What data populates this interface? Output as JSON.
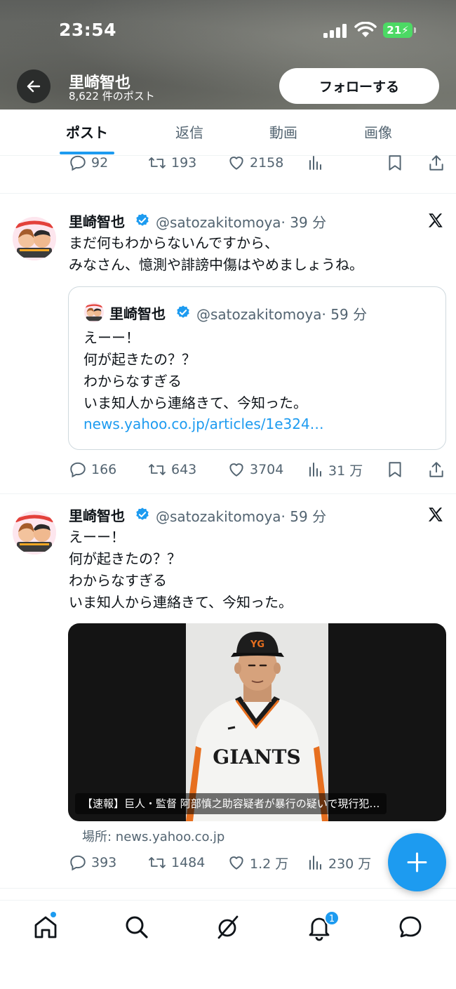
{
  "status_bar": {
    "time": "23:54",
    "battery": "21",
    "battery_color": "#4cd964"
  },
  "header": {
    "back_icon": "arrow-left-icon",
    "profile_name": "里崎智也",
    "post_count": "8,622 件のポスト",
    "follow_label": "フォローする"
  },
  "tabs": [
    {
      "label": "ポスト",
      "active": true
    },
    {
      "label": "返信",
      "active": false
    },
    {
      "label": "動画",
      "active": false
    },
    {
      "label": "画像",
      "active": false
    }
  ],
  "accent_color": "#1d9bf0",
  "top_partial_post": {
    "replies": "92",
    "reposts": "193",
    "likes": "2158"
  },
  "posts": [
    {
      "name": "里崎智也",
      "handle": "@satozakitomoya",
      "time": "· 39 分",
      "text": "まだ何もわからないんですから、\nみなさん、憶測や誹謗中傷はやめましょうね。",
      "quote": {
        "name": "里崎智也",
        "handle": "@satozakitomoya",
        "time": "· 59 分",
        "text": "えーー！\n何が起きたの？？\nわからなすぎる\nいま知人から連絡きて、今知った。",
        "link": "news.yahoo.co.jp/articles/1e324…"
      },
      "replies": "166",
      "reposts": "643",
      "likes": "3704",
      "views": "31 万"
    },
    {
      "name": "里崎智也",
      "handle": "@satozakitomoya",
      "time": "· 59 分",
      "text": "えーー！\n何が起きたの？？\nわからなすぎる\nいま知人から連絡きて、今知った。",
      "media_caption": "【速報】巨人・監督 阿部慎之助容疑者が暴行の疑いで現行犯…",
      "media_source": "場所: news.yahoo.co.jp",
      "jersey_text": "GIANTS",
      "replies": "393",
      "reposts": "1484",
      "likes": "1.2 万",
      "views": "230 万"
    }
  ],
  "bottom_nav": {
    "items": [
      "home-icon",
      "search-icon",
      "grok-icon",
      "notifications-icon",
      "messages-icon"
    ],
    "notification_count": "1"
  }
}
